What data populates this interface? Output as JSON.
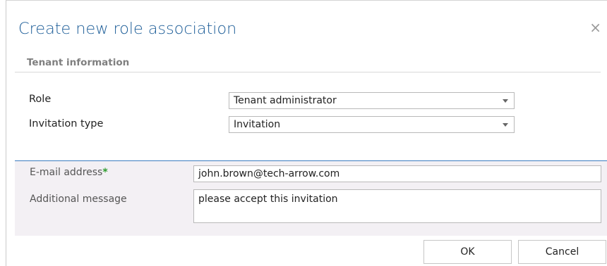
{
  "dialog": {
    "title": "Create new role association",
    "close_glyph": "×"
  },
  "section": {
    "title": "Tenant information"
  },
  "form": {
    "role_label": "Role",
    "role_value": "Tenant administrator",
    "invitation_type_label": "Invitation type",
    "invitation_type_value": "Invitation"
  },
  "invite": {
    "email_label": "E-mail address",
    "email_required_mark": "*",
    "email_value": "john.brown@tech-arrow.com",
    "message_label": "Additional message",
    "message_value": "please accept this invitation"
  },
  "buttons": {
    "ok_label": "OK",
    "cancel_label": "Cancel"
  },
  "colors": {
    "title": "#1f5f99",
    "panel_background": "#f3f0f4",
    "panel_accent": "#3b7cc0",
    "required_mark": "#2e9c2e"
  },
  "icons": {
    "close": "close-icon",
    "dropdown": "chevron-down-icon"
  }
}
